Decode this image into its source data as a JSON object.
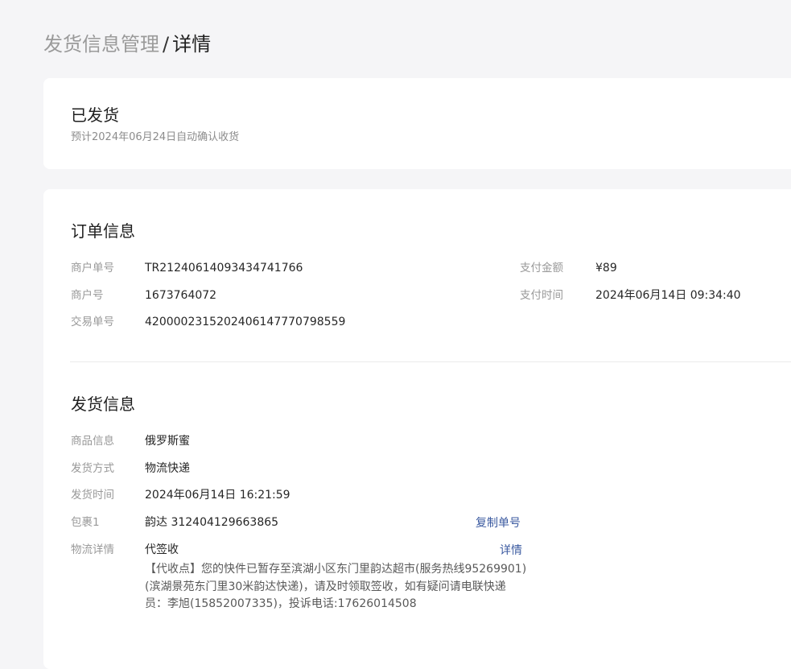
{
  "breadcrumb": {
    "parent": "发货信息管理",
    "separator": "/",
    "current": "详情"
  },
  "status": {
    "title": "已发货",
    "subtitle": "预计2024年06月24日自动确认收货"
  },
  "order": {
    "title": "订单信息",
    "merchant_order_label": "商户单号",
    "merchant_order_value": "TR21240614093434741766",
    "merchant_id_label": "商户号",
    "merchant_id_value": "1673764072",
    "trade_no_label": "交易单号",
    "trade_no_value": "4200002315202406147770798559",
    "amount_label": "支付金额",
    "amount_value": "¥89",
    "pay_time_label": "支付时间",
    "pay_time_value": "2024年06月14日 09:34:40"
  },
  "shipping": {
    "title": "发货信息",
    "product_label": "商品信息",
    "product_value": "俄罗斯蜜",
    "method_label": "发货方式",
    "method_value": "物流快递",
    "time_label": "发货时间",
    "time_value": "2024年06月14日 16:21:59",
    "package_label": "包裹1",
    "package_value": "韵达 312404129663865",
    "copy_label": "复制单号",
    "logistics_label": "物流详情",
    "logistics_status": "代签收",
    "detail_link": "详情",
    "logistics_desc": "【代收点】您的快件已暂存至滨湖小区东门里韵达超市(服务热线95269901)(滨湖景苑东门里30米韵达快递)，请及时领取签收，如有疑问请电联快递员：李旭(15852007335)，投诉电话:17626014508"
  }
}
